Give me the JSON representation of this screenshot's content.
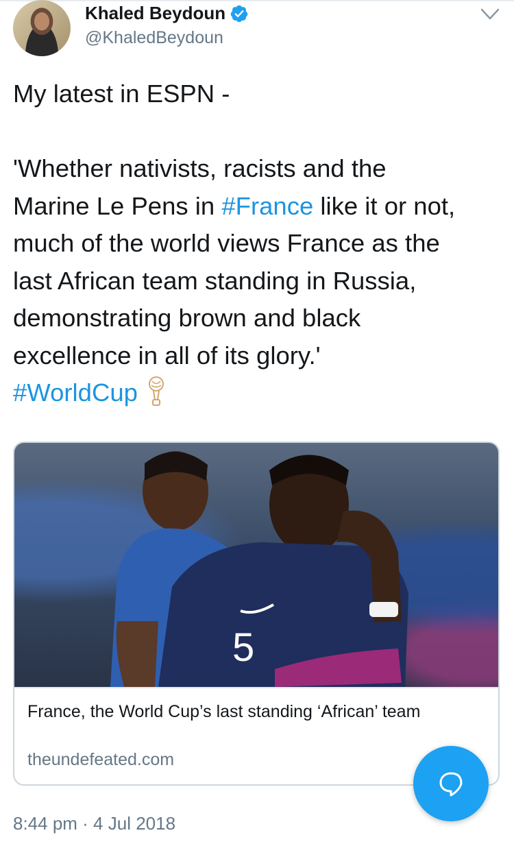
{
  "author": {
    "name": "Khaled Beydoun",
    "handle": "@KhaledBeydoun",
    "verified": true
  },
  "tweet": {
    "line1": "My latest in ESPN -",
    "quote_lines": [
      {
        "text": "'Whether nativists, racists and the"
      },
      {
        "before": "Marine Le Pens in ",
        "hashtag": "#France",
        "after": " like it or not,"
      },
      {
        "text": "much of the world views France as the"
      },
      {
        "text": "last African team standing in Russia,"
      },
      {
        "text": "demonstrating brown and black"
      },
      {
        "text": "excellence in all of its glory.'"
      }
    ],
    "hashtag_worldcup": "#WorldCup",
    "emoji": "trophy-icon"
  },
  "link_card": {
    "title": "France, the World Cup’s last standing ‘African’ team",
    "domain": "theundefeated.com",
    "image_description_icon": "photo"
  },
  "timestamp": "8:44 pm · 4 Jul 2018",
  "colors": {
    "link": "#1b95e0",
    "fab": "#1da1f2",
    "secondary_text": "#657786"
  }
}
